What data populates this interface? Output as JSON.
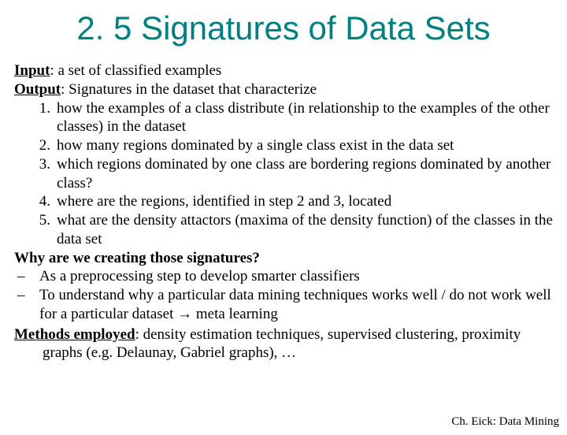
{
  "title": "2. 5 Signatures of Data Sets",
  "input_label": "Input",
  "input_text": ": a set of classified examples",
  "output_label": "Output",
  "output_text": ": Signatures in the dataset that characterize",
  "items": {
    "n1": "1.",
    "t1": "how the examples of a class distribute (in relationship to the examples of the other classes) in the dataset",
    "n2": "2.",
    "t2": "how many regions dominated by a single class exist in the data set",
    "n3": "3.",
    "t3": "which regions dominated by one class are bordering regions dominated by another class?",
    "n4": "4.",
    "t4": "where are the regions, identified in step 2 and 3,  located",
    "n5": "5.",
    "t5": "what are the density attactors (maxima of the density function) of the classes in the data set"
  },
  "why_label": "Why are we creating those signatures?",
  "dash": "–",
  "why1": "As a preprocessing step to develop smarter classifiers",
  "why2_a": "To understand why a particular data mining techniques works well / do not work well for a particular dataset ",
  "arrow": "→",
  "why2_b": " meta learning",
  "methods_label": "Methods employed",
  "methods_text": ": density estimation techniques, supervised clustering, proximity graphs (e.g. Delaunay, Gabriel graphs), …",
  "footer": "Ch. Eick: Data Mining"
}
